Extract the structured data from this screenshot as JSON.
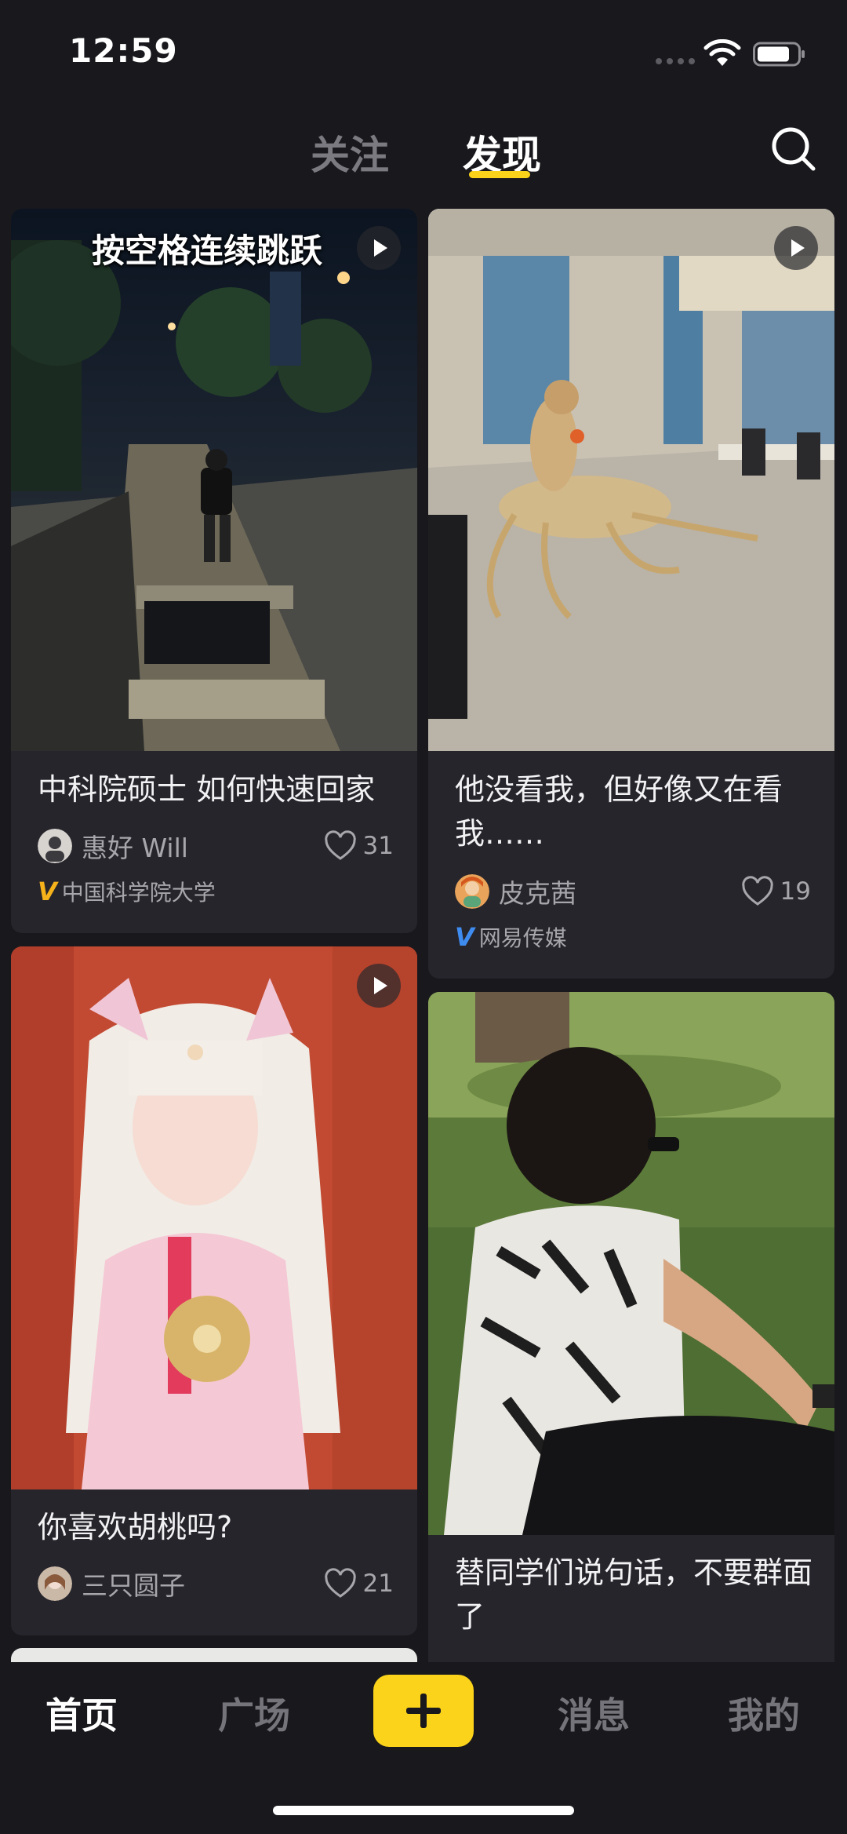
{
  "status_bar": {
    "time": "12:59",
    "icons": [
      "signal-dots-icon",
      "wifi-icon",
      "battery-icon"
    ]
  },
  "top_tabs": {
    "items": [
      {
        "label": "关注",
        "active": false
      },
      {
        "label": "发现",
        "active": true
      }
    ],
    "search_icon": "search-icon"
  },
  "feed": {
    "cards": [
      {
        "title": "中科院硕士 如何快速回家",
        "overlay_caption": "按空格连续跳跃",
        "is_video": true,
        "author": "惠好 Will",
        "likes": "31",
        "verified_org": "中国科学院大学",
        "verify_color": "#f5b21a"
      },
      {
        "title": "他没看我，但好像又在看我……",
        "is_video": true,
        "author": "皮克茜",
        "likes": "19",
        "verified_org": "网易传媒",
        "verify_color": "#3f8cf0"
      },
      {
        "title": "你喜欢胡桃吗?",
        "is_video": true,
        "author": "三只圆子",
        "likes": "21"
      },
      {
        "title": "替同学们说句话，不要群面了",
        "is_video": false
      }
    ]
  },
  "bottom_nav": {
    "items": [
      {
        "label": "首页",
        "active": true
      },
      {
        "label": "广场",
        "active": false
      },
      {
        "label": "消息",
        "active": false
      },
      {
        "label": "我的",
        "active": false
      }
    ],
    "add_icon": "plus-icon"
  },
  "colors": {
    "background": "#19181d",
    "card": "#26252b",
    "accent": "#fbd31a",
    "muted_text": "#a7a6ab"
  }
}
